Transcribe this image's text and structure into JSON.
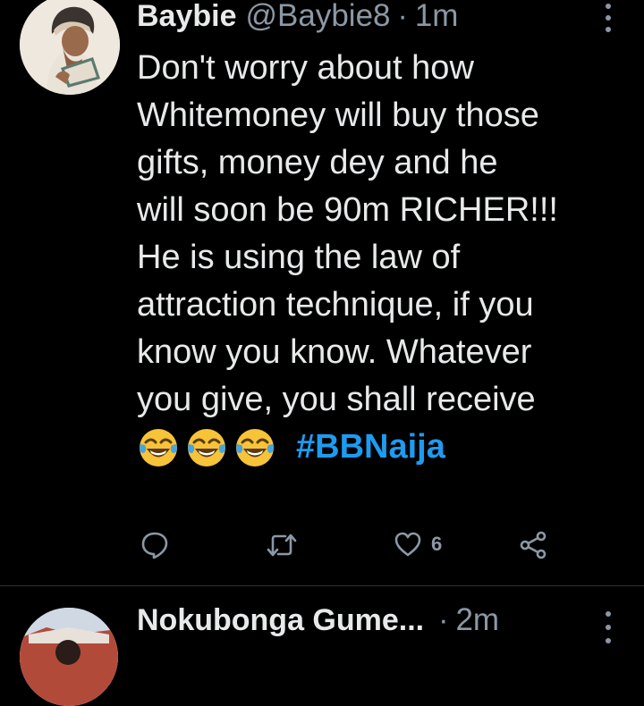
{
  "tweet": {
    "name": "Baybie",
    "handle": "@Baybie8",
    "separator": "·",
    "time": "1m",
    "lines": [
      "Don't worry about how",
      "Whitemoney will buy those",
      "gifts, money dey and he",
      "will soon be 90m RICHER!!!",
      "He is using the law of",
      "attraction technique, if you",
      "know you know. Whatever",
      "you give, you shall receive"
    ],
    "hashtag": "#BBNaija",
    "emoji": [
      "face-with-tears-of-joy",
      "face-with-tears-of-joy",
      "face-with-tears-of-joy"
    ],
    "like_count": "6"
  },
  "next_tweet": {
    "name": "Nokubonga Gume...",
    "separator": "·",
    "time": "2m"
  },
  "colors": {
    "background": "#000000",
    "text": "#e7e9ea",
    "muted": "#8b98a5",
    "link": "#1d9bf0",
    "emoji": "#f7c338"
  }
}
